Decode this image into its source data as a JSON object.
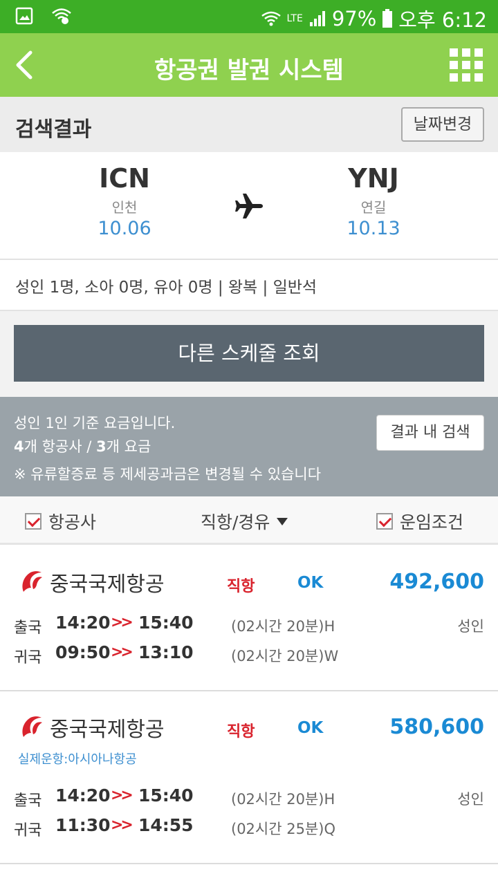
{
  "status_bar": {
    "network": "LTE",
    "battery": "97%",
    "time": "오후 6:12"
  },
  "app_bar": {
    "title": "항공권 발권 시스템"
  },
  "result": {
    "title": "검색결과",
    "date_change_label": "날짜변경"
  },
  "route": {
    "from": {
      "code": "ICN",
      "name": "인천",
      "date": "10.06"
    },
    "to": {
      "code": "YNJ",
      "name": "연길",
      "date": "10.13"
    }
  },
  "passengers": "성인 1명, 소아 0명, 유아 0명 | 왕복 | 일반석",
  "other_schedule_label": "다른 스케줄 조회",
  "info": {
    "line1": "성인 1인 기준 요금입니다.",
    "count_airlines": "4",
    "airlines_suffix": "개 항공사 / ",
    "count_fares": "3",
    "fares_suffix": "개 요금",
    "note": "※ 유류할증료 등 제세공과금은 변경될 수 있습니다",
    "in_search_label": "결과 내 검색"
  },
  "filters": {
    "airline": "항공사",
    "direct_transfer": "직항/경유",
    "fare_conditions": "운임조건"
  },
  "flights": [
    {
      "airline": "중국국제항공",
      "type": "직항",
      "status": "OK",
      "price": "492,600",
      "operated_by": "",
      "legs": [
        {
          "label": "출국",
          "dep": "14:20",
          "arr": "15:40",
          "duration": "(02시간 20분)H",
          "pax": "성인"
        },
        {
          "label": "귀국",
          "dep": "09:50",
          "arr": "13:10",
          "duration": "(02시간 20분)W",
          "pax": ""
        }
      ]
    },
    {
      "airline": "중국국제항공",
      "type": "직항",
      "status": "OK",
      "price": "580,600",
      "operated_by": "실제운항:아시아나항공",
      "legs": [
        {
          "label": "출국",
          "dep": "14:20",
          "arr": "15:40",
          "duration": "(02시간 20분)H",
          "pax": "성인"
        },
        {
          "label": "귀국",
          "dep": "11:30",
          "arr": "14:55",
          "duration": "(02시간 25분)Q",
          "pax": ""
        }
      ]
    }
  ],
  "colors": {
    "status_bar": "#3dae26",
    "app_bar": "#8fd14f",
    "price": "#1a8ad4",
    "direct": "#d9232d",
    "date": "#3d8fd0"
  },
  "icons": {
    "back": "chevron-left-icon",
    "menu": "grid-icon",
    "plane": "airplane-icon",
    "airline_logo": "air-china-logo-icon"
  }
}
